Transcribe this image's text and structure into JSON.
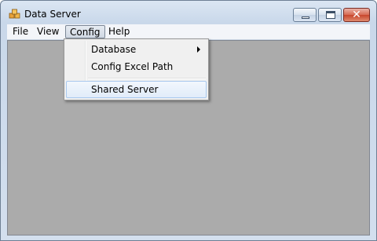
{
  "window": {
    "title": "Data Server"
  },
  "menubar": {
    "file": "File",
    "view": "View",
    "config": "Config",
    "help": "Help"
  },
  "config_menu": {
    "items": [
      {
        "label": "Database",
        "has_submenu": true
      },
      {
        "label": "Config Excel Path",
        "has_submenu": false
      },
      {
        "label": "Shared Server",
        "has_submenu": false,
        "highlighted": true
      }
    ]
  },
  "icons": {
    "app": "database-cubes-icon",
    "minimize": "minimize-icon",
    "maximize": "maximize-icon",
    "close": "close-icon",
    "submenu": "submenu-arrow-icon"
  },
  "colors": {
    "client_area": "#ababab",
    "close_button": "#c7452c",
    "highlight": "#e1ecf9"
  }
}
